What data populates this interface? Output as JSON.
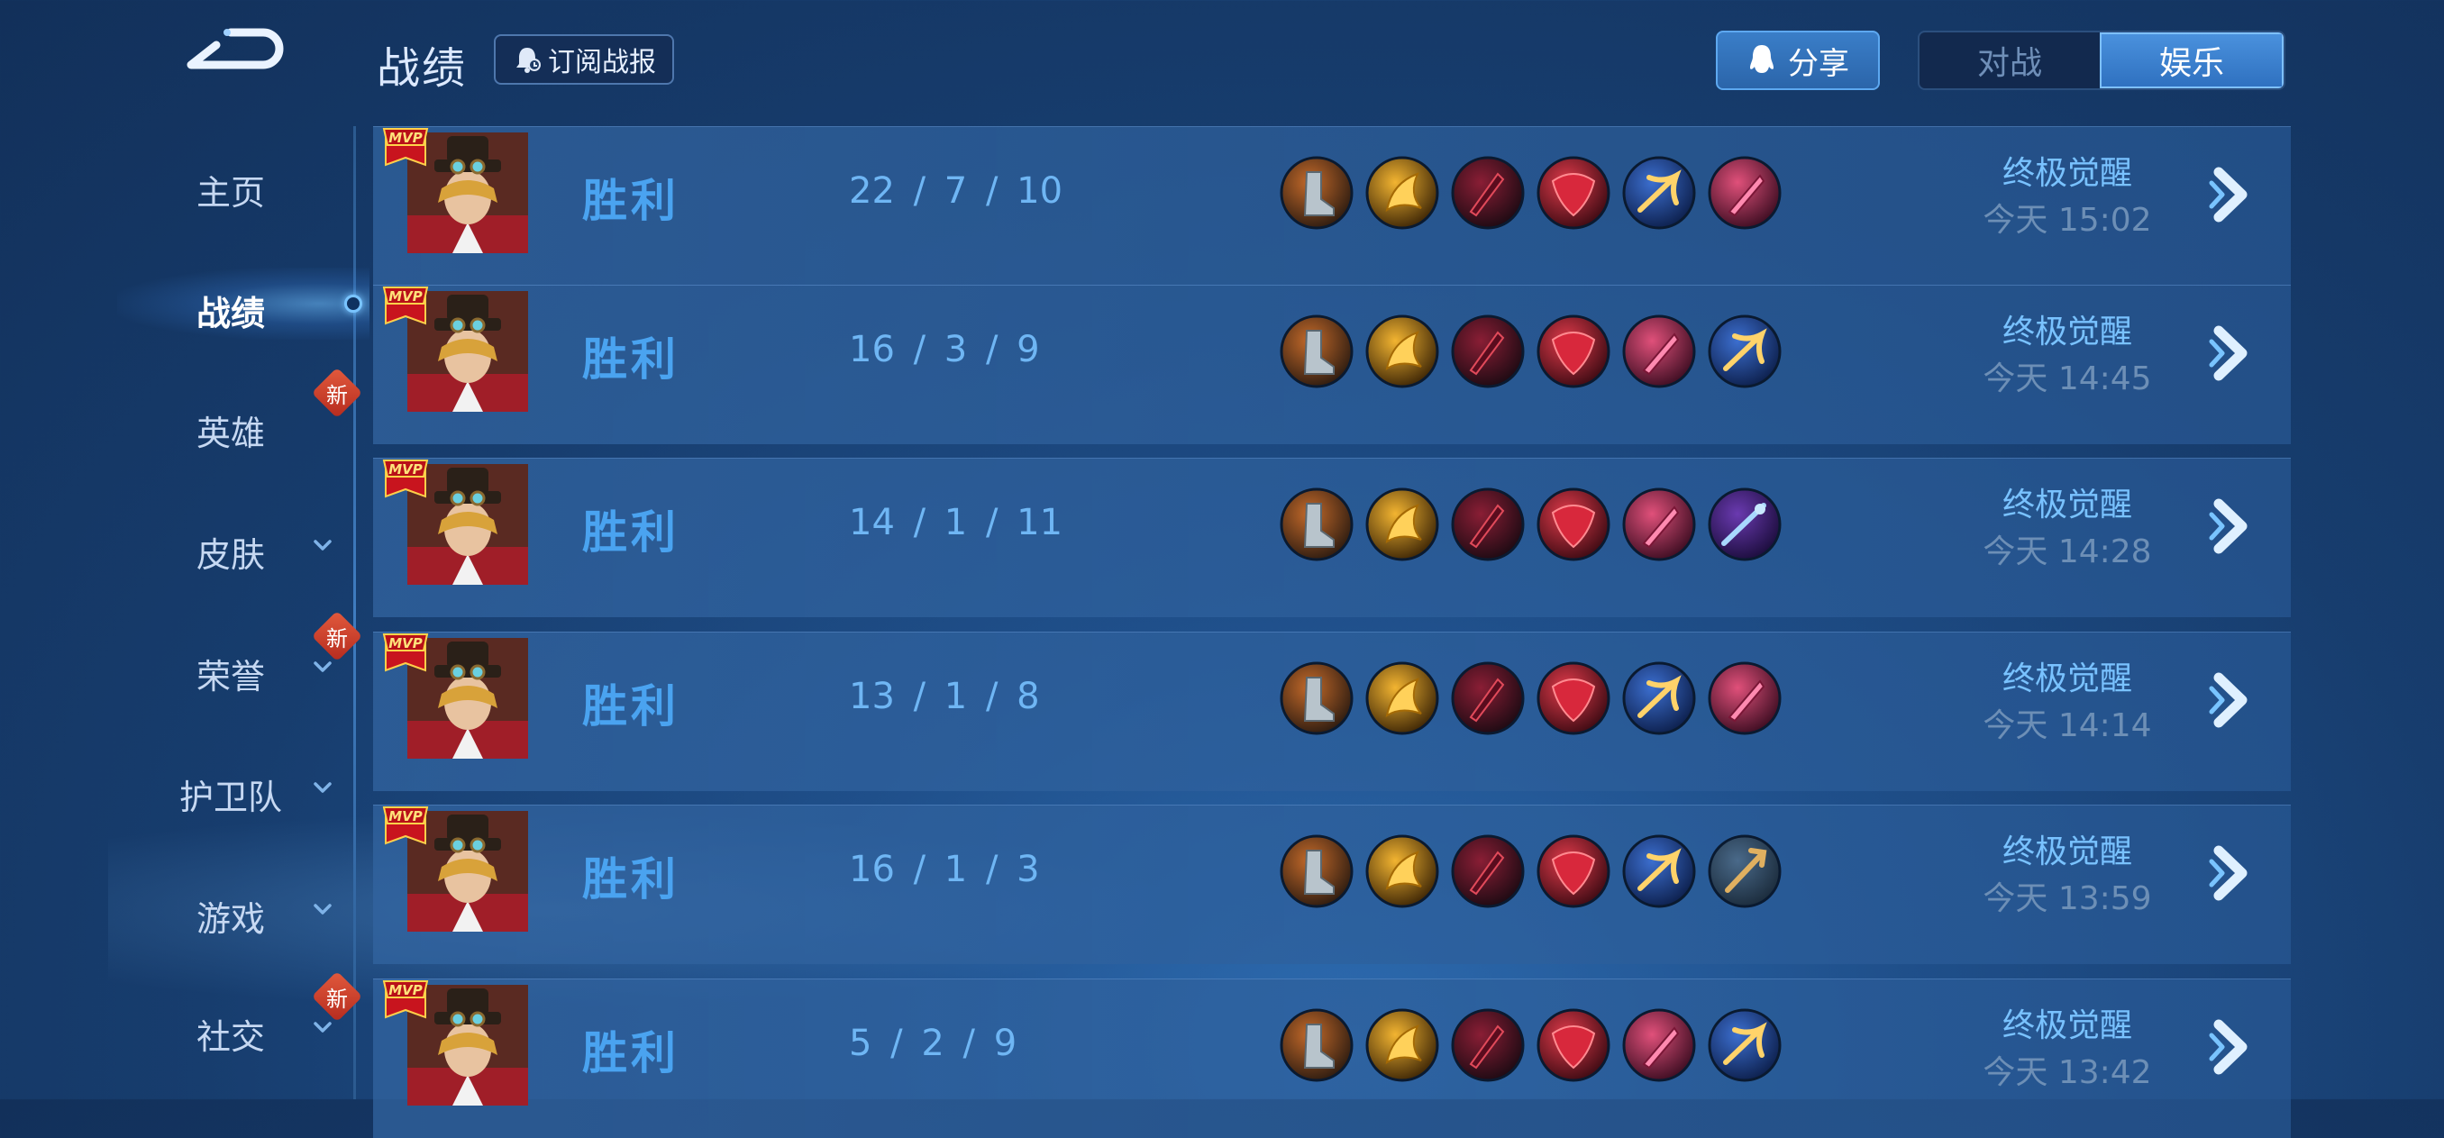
{
  "header": {
    "title": "战绩",
    "subscribe_label": "订阅战报",
    "share_label": "分享",
    "mode_tabs": [
      {
        "label": "对战",
        "active": false
      },
      {
        "label": "娱乐",
        "active": true
      }
    ]
  },
  "sidebar": {
    "items": [
      {
        "label": "主页",
        "active": false,
        "chevron": false,
        "new": false
      },
      {
        "label": "战绩",
        "active": true,
        "chevron": false,
        "new": false
      },
      {
        "label": "英雄",
        "active": false,
        "chevron": false,
        "new": true
      },
      {
        "label": "皮肤",
        "active": false,
        "chevron": true,
        "new": false
      },
      {
        "label": "荣誉",
        "active": false,
        "chevron": true,
        "new": true
      },
      {
        "label": "护卫队",
        "active": false,
        "chevron": true,
        "new": false
      },
      {
        "label": "游戏",
        "active": false,
        "chevron": true,
        "new": false
      },
      {
        "label": "社交",
        "active": false,
        "chevron": true,
        "new": true
      }
    ],
    "new_badge_label": "新"
  },
  "badge_text": "MVP",
  "matches": [
    {
      "result": "胜利",
      "kda": "22 / 7 / 10",
      "mode": "终极觉醒",
      "time": "今天 15:02",
      "items": [
        "boots-item-icon",
        "golden-bow-item-icon",
        "crimson-blade-item-icon",
        "red-crest-item-icon",
        "blue-gold-axe-item-icon",
        "pink-blade-item-icon"
      ]
    },
    {
      "result": "胜利",
      "kda": "16 / 3 / 9",
      "mode": "终极觉醒",
      "time": "今天 14:45",
      "items": [
        "boots-item-icon",
        "golden-bow-item-icon",
        "crimson-blade-item-icon",
        "red-crest-item-icon",
        "pink-blade-item-icon",
        "blue-gold-axe-item-icon"
      ]
    },
    {
      "result": "胜利",
      "kda": "14 / 1 / 11",
      "mode": "终极觉醒",
      "time": "今天 14:28",
      "items": [
        "boots-item-icon",
        "golden-bow-item-icon",
        "crimson-blade-item-icon",
        "red-crest-item-icon",
        "pink-blade-item-icon",
        "purple-spear-item-icon"
      ]
    },
    {
      "result": "胜利",
      "kda": "13 / 1 / 8",
      "mode": "终极觉醒",
      "time": "今天 14:14",
      "items": [
        "boots-item-icon",
        "golden-bow-item-icon",
        "crimson-blade-item-icon",
        "red-crest-item-icon",
        "blue-gold-axe-item-icon",
        "pink-blade-item-icon"
      ]
    },
    {
      "result": "胜利",
      "kda": "16 / 1 / 3",
      "mode": "终极觉醒",
      "time": "今天 13:59",
      "items": [
        "boots-item-icon",
        "golden-bow-item-icon",
        "crimson-blade-item-icon",
        "red-crest-item-icon",
        "blue-gold-axe-item-icon",
        "bronze-trident-item-icon"
      ]
    },
    {
      "result": "胜利",
      "kda": "5 / 2 / 9",
      "mode": "终极觉醒",
      "time": "今天 13:42",
      "items": [
        "boots-item-icon",
        "golden-bow-item-icon",
        "crimson-blade-item-icon",
        "red-crest-item-icon",
        "pink-blade-item-icon",
        "blue-gold-axe-item-icon"
      ]
    }
  ],
  "colors": {
    "accent": "#4aa3f0",
    "active_tab": "#3a82d0",
    "row_bg": "#2f639e",
    "new_badge": "#d2452e"
  }
}
